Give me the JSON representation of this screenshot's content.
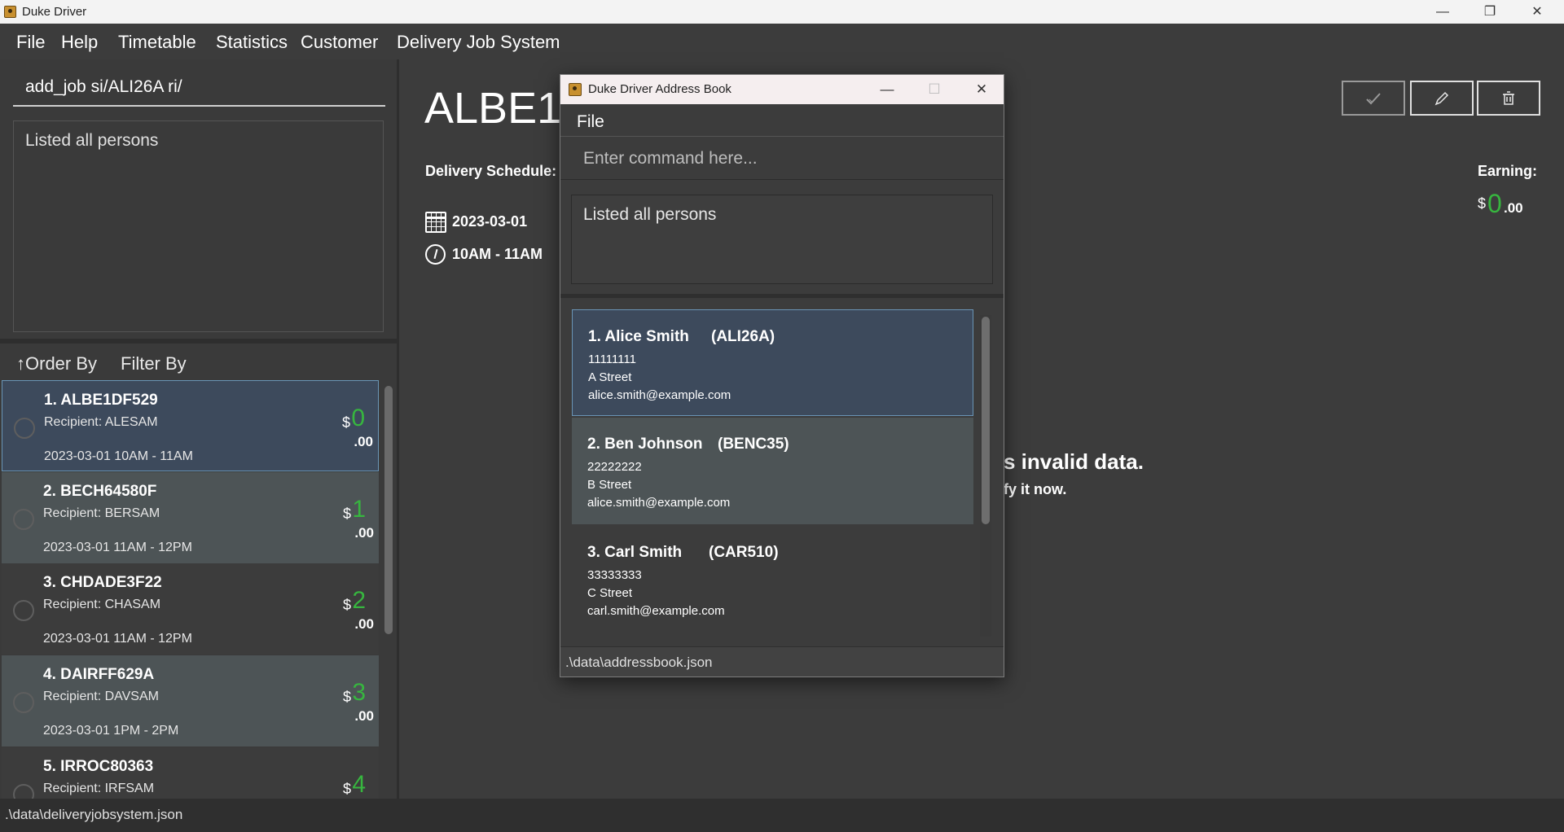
{
  "window": {
    "title": "Duke Driver",
    "minimize": "—",
    "restore": "❐",
    "close": "✕"
  },
  "menu": [
    "File",
    "Help",
    "Timetable",
    "Statistics",
    "Customer",
    "Delivery Job System"
  ],
  "left": {
    "command_value": "add_job si/ALI26A ri/",
    "result": "Listed all persons",
    "order_by": "↑Order By",
    "filter_by": "Filter By",
    "currency": "$",
    "cents": ".00",
    "jobs": [
      {
        "title": "1.  ALBE1DF529",
        "recipient": "Recipient: ALESAM",
        "when": "2023-03-01 10AM - 11AM",
        "amount": "0"
      },
      {
        "title": "2.  BECH64580F",
        "recipient": "Recipient: BERSAM",
        "when": "2023-03-01 11AM - 12PM",
        "amount": "1"
      },
      {
        "title": "3.  CHDADE3F22",
        "recipient": "Recipient: CHASAM",
        "when": "2023-03-01 11AM - 12PM",
        "amount": "2"
      },
      {
        "title": "4.  DAIRFF629A",
        "recipient": "Recipient: DAVSAM",
        "when": "2023-03-01 1PM  - 2PM",
        "amount": "3"
      },
      {
        "title": "5.  IRROC80363",
        "recipient": "Recipient: IRFSAM",
        "when": "",
        "amount": "4"
      }
    ]
  },
  "detail": {
    "title": "ALBE1D",
    "schedule_label": "Delivery Schedule:",
    "date": "2023-03-01",
    "time": "10AM - 11AM",
    "earning_label": "Earning:",
    "earning_currency": "$",
    "earning_amount": "0",
    "earning_cents": ".00",
    "invalid_main": "s invalid data.",
    "invalid_sub": "fy it now."
  },
  "status": ".\\data\\deliveryjobsystem.json",
  "dialog": {
    "title": "Duke Driver Address Book",
    "minimize": "—",
    "maximize": "☐",
    "close": "✕",
    "menu_file": "File",
    "command_placeholder": "Enter command here...",
    "result": "Listed all persons",
    "status": ".\\data\\addressbook.json",
    "persons": [
      {
        "name": "1.  Alice Smith",
        "id": "(ALI26A)",
        "phone": "11111111",
        "address": "A Street",
        "email": "alice.smith@example.com"
      },
      {
        "name": "2.  Ben Johnson",
        "id": "(BENC35)",
        "phone": "22222222",
        "address": "B Street",
        "email": "alice.smith@example.com"
      },
      {
        "name": "3.  Carl Smith",
        "id": "(CAR510)",
        "phone": "33333333",
        "address": "C Street",
        "email": "carl.smith@example.com"
      }
    ]
  }
}
